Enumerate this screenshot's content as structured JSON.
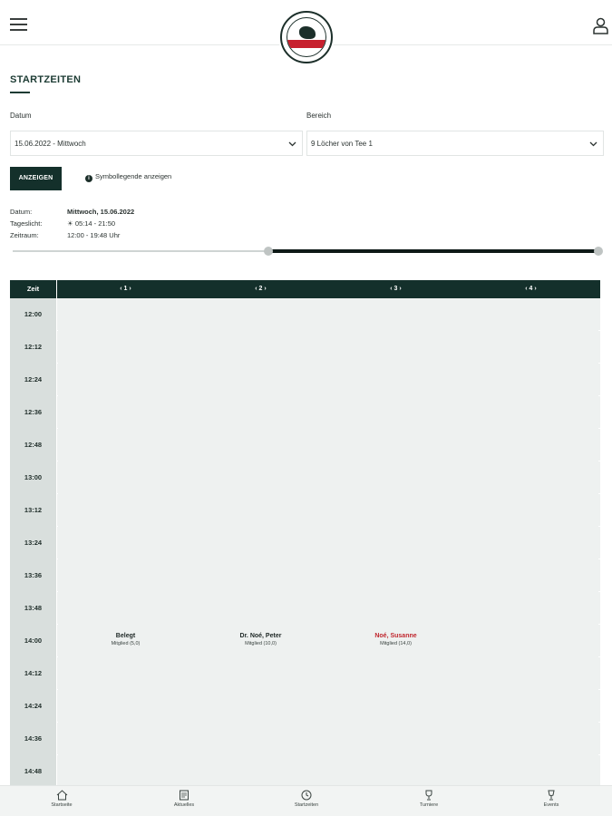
{
  "header": {
    "logo_top_text": "",
    "logo_bottom_text": ""
  },
  "page": {
    "title": "STARTZEITEN"
  },
  "filters": {
    "date_label": "Datum",
    "date_value": "15.06.2022 - Mittwoch",
    "area_label": "Bereich",
    "area_value": "9 Löcher von Tee 1",
    "show_button": "ANZEIGEN",
    "legend_link": "Symbollegende anzeigen"
  },
  "info": {
    "date_key": "Datum:",
    "date_val": "Mittwoch, 15.06.2022",
    "daylight_key": "Tageslicht:",
    "daylight_val": "05:14 - 21:50",
    "period_key": "Zeitraum:",
    "period_val": "12:00 - 19:48 Uhr"
  },
  "slider": {
    "range_start_fraction": 0.36,
    "range_end_fraction": 1.0
  },
  "table": {
    "time_header": "Zeit",
    "tee_headers": [
      "‹ 1 ›",
      "‹ 2 ›",
      "‹ 3 ›",
      "‹ 4 ›"
    ],
    "rows": [
      {
        "time": "12:00",
        "slots": [
          null,
          null,
          null,
          null
        ]
      },
      {
        "time": "12:12",
        "slots": [
          null,
          null,
          null,
          null
        ]
      },
      {
        "time": "12:24",
        "slots": [
          null,
          null,
          null,
          null
        ]
      },
      {
        "time": "12:36",
        "slots": [
          null,
          null,
          null,
          null
        ]
      },
      {
        "time": "12:48",
        "slots": [
          null,
          null,
          null,
          null
        ]
      },
      {
        "time": "13:00",
        "slots": [
          null,
          null,
          null,
          null
        ]
      },
      {
        "time": "13:12",
        "slots": [
          null,
          null,
          null,
          null
        ]
      },
      {
        "time": "13:24",
        "slots": [
          null,
          null,
          null,
          null
        ]
      },
      {
        "time": "13:36",
        "slots": [
          null,
          null,
          null,
          null
        ]
      },
      {
        "time": "13:48",
        "slots": [
          null,
          null,
          null,
          null
        ]
      },
      {
        "time": "14:00",
        "slots": [
          {
            "name": "Belegt",
            "sub": "Mitglied (5,0)",
            "highlight": false
          },
          {
            "name": "Dr. Noé, Peter",
            "sub": "Mitglied (10,0)",
            "highlight": false
          },
          {
            "name": "Noé, Susanne",
            "sub": "Mitglied (14,0)",
            "highlight": true
          },
          null
        ]
      },
      {
        "time": "14:12",
        "slots": [
          null,
          null,
          null,
          null
        ]
      },
      {
        "time": "14:24",
        "slots": [
          null,
          null,
          null,
          null
        ]
      },
      {
        "time": "14:36",
        "slots": [
          null,
          null,
          null,
          null
        ]
      },
      {
        "time": "14:48",
        "slots": [
          null,
          null,
          null,
          null
        ]
      }
    ]
  },
  "bottom_nav": {
    "items": [
      {
        "label": "Startseite",
        "icon": "home-icon"
      },
      {
        "label": "Aktuelles",
        "icon": "news-icon"
      },
      {
        "label": "Startzeiten",
        "icon": "clock-icon"
      },
      {
        "label": "Turniere",
        "icon": "trophy-icon"
      },
      {
        "label": "Events",
        "icon": "glass-icon"
      }
    ]
  },
  "colors": {
    "brand_dark": "#14302b",
    "highlight_red": "#c0282f",
    "table_bg": "#eef1f0",
    "time_cell_bg": "#d9dfdd"
  }
}
